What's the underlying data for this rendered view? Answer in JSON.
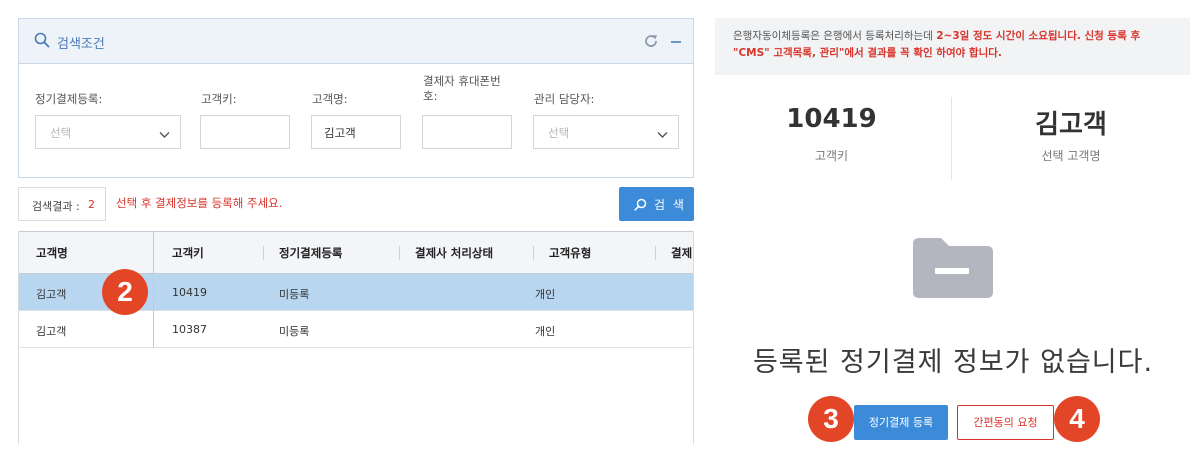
{
  "search": {
    "title": "검색조건",
    "fields": {
      "billing_registration": {
        "label": "정기결제등록:",
        "placeholder": "선택"
      },
      "customer_key": {
        "label": "고객키:",
        "value": ""
      },
      "customer_name": {
        "label": "고객명:",
        "value": "김고객"
      },
      "payer_phone": {
        "label": "결제자 휴대폰번호:",
        "value": ""
      },
      "manager": {
        "label": "관리 담당자:",
        "placeholder": "선택"
      }
    }
  },
  "results": {
    "count_label": "검색결과 :",
    "count": "2",
    "hint": "선택 후 결제정보를 등록해 주세요.",
    "search_button": "검 색"
  },
  "table": {
    "columns": [
      "고객명",
      "고객키",
      "정기결제등록",
      "결제사 처리상태",
      "고객유형",
      "결제"
    ],
    "rows": [
      {
        "name": "김고객",
        "key": "10419",
        "registration": "미등록",
        "status": "",
        "type": "개인",
        "selected": true
      },
      {
        "name": "김고객",
        "key": "10387",
        "registration": "미등록",
        "status": "",
        "type": "개인",
        "selected": false
      }
    ]
  },
  "notice": {
    "text1": "은행자동이체등록은 은행에서 등록처리하는데 ",
    "text2": "2~3일 정도 시간이 소요됩니다. 신청 등록 후 \"CMS\" 고객목록, 관리\"에서 결과를 꼭 확인 하여야 합니다."
  },
  "summary": {
    "customer_key": "10419",
    "customer_key_label": "고객키",
    "customer_name": "김고객",
    "customer_name_label": "선택 고객명"
  },
  "empty_state": {
    "message": "등록된 정기결제 정보가 없습니다.",
    "register_button": "정기결제 등록",
    "request_button": "간편동의 요청"
  },
  "badges": [
    "2",
    "3",
    "4"
  ],
  "colors": {
    "accent": "#3b8bd8",
    "alert": "#d9342b",
    "badge": "#e34627",
    "selected_row": "#b9d6f0"
  }
}
